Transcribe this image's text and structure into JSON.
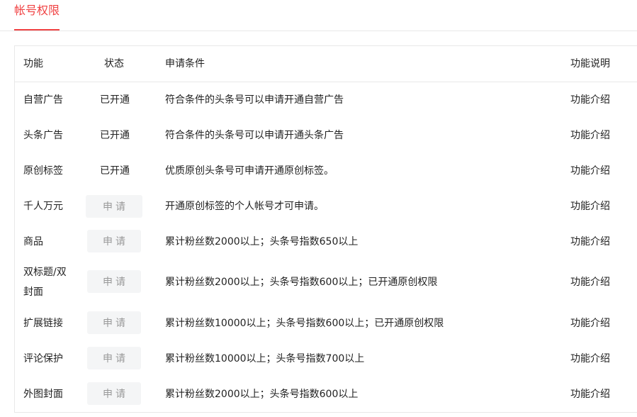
{
  "tabs": {
    "active": "帐号权限"
  },
  "table": {
    "headers": {
      "function": "功能",
      "status": "状态",
      "condition": "申请条件",
      "description": "功能说明"
    },
    "rows": [
      {
        "function": "自营广告",
        "status_text": "已开通",
        "condition": "符合条件的头条号可以申请开通自营广告",
        "link": "功能介绍"
      },
      {
        "function": "头条广告",
        "status_text": "已开通",
        "condition": "符合条件的头条号可以申请开通头条广告",
        "link": "功能介绍"
      },
      {
        "function": "原创标签",
        "status_text": "已开通",
        "condition": "优质原创头条号可申请开通原创标签。",
        "link": "功能介绍"
      },
      {
        "function": "千人万元",
        "button": "申请",
        "condition": "开通原创标签的个人帐号才可申请。",
        "link": "功能介绍"
      },
      {
        "function": "商品",
        "button": "申请",
        "condition": "累计粉丝数2000以上；头条号指数650以上",
        "link": "功能介绍"
      },
      {
        "function": "双标题/双封面",
        "button": "申请",
        "condition": "累计粉丝数2000以上；头条号指数600以上；已开通原创权限",
        "link": "功能介绍"
      },
      {
        "function": "扩展链接",
        "button": "申请",
        "condition": "累计粉丝数10000以上；头条号指数600以上；已开通原创权限",
        "link": "功能介绍"
      },
      {
        "function": "评论保护",
        "button": "申请",
        "condition": "累计粉丝数10000以上；头条号指数700以上",
        "link": "功能介绍"
      },
      {
        "function": "外图封面",
        "button": "申请",
        "condition": "累计粉丝数2000以上；头条号指数600以上",
        "link": "功能介绍"
      }
    ]
  },
  "colors": {
    "accent": "#f04142",
    "open": "#2cb34a",
    "link": "#406599"
  }
}
